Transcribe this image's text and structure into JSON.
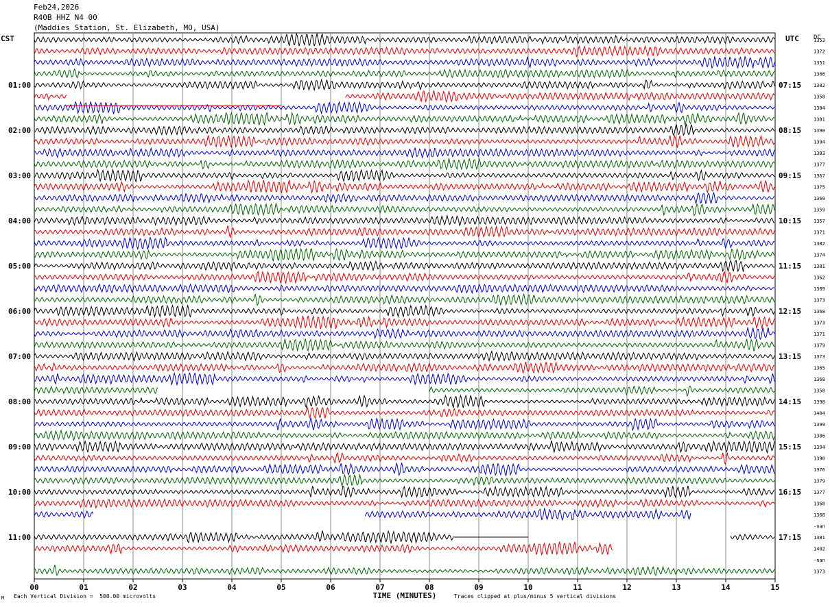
{
  "header": {
    "date": "Feb24,2026",
    "channel": "R40B HHZ N4 00",
    "station": "(Maddies Station, St. Elizabeth, MO, USA)"
  },
  "corner_labels": {
    "left": "CST",
    "right": "UTC",
    "dc": "DC"
  },
  "footer": {
    "scale": "Each Vertical Division =  500.00 microvolts",
    "clip": "Traces clipped at plus/minus 5 vertical divisions",
    "mark": "M"
  },
  "colors": {
    "black": "#000000",
    "red": "#e00000",
    "blue": "#0000cc",
    "green": "#006400",
    "grid": "#888888"
  },
  "chart_data": {
    "type": "line",
    "title": "Feb24,2026 R40B HHZ N4 00 (Maddies Station, St. Elizabeth, MO, USA)",
    "xlabel": "TIME (MINUTES)",
    "ylabel": "",
    "xlim": [
      0,
      15
    ],
    "x_ticks": [
      "00",
      "01",
      "02",
      "03",
      "04",
      "05",
      "06",
      "07",
      "08",
      "09",
      "10",
      "11",
      "12",
      "13",
      "14",
      "15"
    ],
    "color_cycle": [
      "black",
      "red",
      "blue",
      "green"
    ],
    "cst_labels": [
      "01:00",
      "02:00",
      "03:00",
      "04:00",
      "05:00",
      "06:00",
      "07:00",
      "08:00",
      "09:00",
      "10:00",
      "11:00"
    ],
    "utc_labels": [
      "07:15",
      "08:15",
      "09:15",
      "10:15",
      "11:15",
      "12:15",
      "13:15",
      "14:15",
      "15:15",
      "16:15",
      "17:15"
    ],
    "dc_offsets": [
      "1353",
      "1372",
      "1351",
      "1366",
      "1382",
      "1358",
      "1384",
      "1381",
      "1390",
      "1394",
      "1383",
      "1377",
      "1367",
      "1375",
      "1360",
      "1359",
      "1357",
      "1371",
      "1382",
      "1374",
      "1381",
      "1362",
      "1369",
      "1373",
      "1368",
      "1373",
      "1371",
      "1379",
      "1373",
      "1365",
      "1368",
      "1358",
      "1398",
      "1404",
      "1399",
      "1386",
      "1394",
      "1390",
      "1376",
      "1379",
      "1377",
      "1368",
      "1368",
      "-nan",
      "1381",
      "1402",
      "-nan",
      "1373"
    ],
    "gaps": [
      {
        "trace": 5,
        "segments": [
          [
            0,
            0.65
          ],
          [
            6.3,
            15
          ]
        ],
        "flatline": [
          [
            0.65,
            5.0
          ]
        ]
      },
      {
        "trace": 31,
        "segments": [
          [
            0,
            2.5
          ],
          [
            8.0,
            15
          ]
        ]
      },
      {
        "trace": 42,
        "segments": [
          [
            0,
            1.2
          ],
          [
            6.7,
            13.3
          ]
        ]
      },
      {
        "trace": 43,
        "segments": []
      },
      {
        "trace": 44,
        "segments": [
          [
            0,
            8.5
          ],
          [
            14.1,
            15
          ]
        ],
        "flatline": [
          [
            8.5,
            10.0
          ]
        ]
      },
      {
        "trace": 45,
        "segments": [
          [
            0,
            11.7
          ]
        ]
      },
      {
        "trace": 46,
        "segments": []
      }
    ]
  }
}
